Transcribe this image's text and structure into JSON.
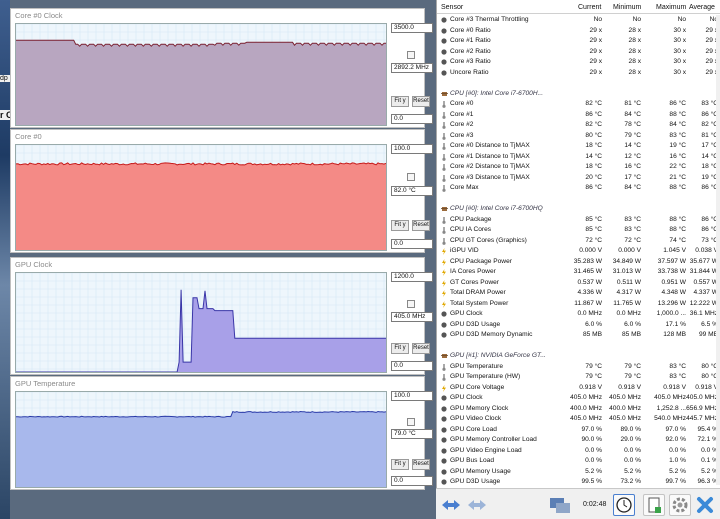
{
  "desktop": {
    "labels": [
      "...",
      "dp",
      "r C"
    ]
  },
  "graphs": [
    {
      "title": "Core #0 Clock",
      "max": "3500.0",
      "current": "2892.2 MHz",
      "min": "0.0",
      "fit": "Fit y",
      "reset": "Reset",
      "fill": "#b8a6c0",
      "line": "#7a2030",
      "grid": "#d6e8f6",
      "level": [
        0.84,
        0.78
      ],
      "kind": "clock"
    },
    {
      "title": "Core #0",
      "max": "100.0",
      "current": "82.0 °C",
      "min": "0.0",
      "fit": "Fit y",
      "reset": "Reset",
      "fill": "#f48a86",
      "line": "#c61a1a",
      "grid": "#d6e8f6",
      "level": [
        0.82,
        0.82
      ],
      "kind": "temp"
    },
    {
      "title": "GPU Clock",
      "max": "1200.0",
      "current": "405.0 MHz",
      "min": "0.0",
      "fit": "Fit y",
      "reset": "Reset",
      "fill": "#a8a0e8",
      "line": "#3a36a8",
      "grid": "#d6e8f6",
      "level": [
        0.0,
        0.34
      ],
      "kind": "gpuclock"
    },
    {
      "title": "GPU Temperature",
      "max": "100.0",
      "current": "79.0 °C",
      "min": "0.0",
      "fit": "Fit y",
      "reset": "Reset",
      "fill": "#a8b8ec",
      "line": "#2a3aa8",
      "grid": "#d6e8f6",
      "level": [
        0.74,
        0.79
      ],
      "kind": "gputemp"
    }
  ],
  "columns": {
    "sensor": "Sensor",
    "current": "Current",
    "minimum": "Minimum",
    "maximum": "Maximum",
    "average": "Average"
  },
  "rows": [
    {
      "n": "Core #3 Thermal Throttling",
      "c": "No",
      "mi": "No",
      "ma": "No",
      "a": "No",
      "icon": "dot"
    },
    {
      "n": "Core #0 Ratio",
      "c": "29 x",
      "mi": "28 x",
      "ma": "30 x",
      "a": "29 x",
      "icon": "dot"
    },
    {
      "n": "Core #1 Ratio",
      "c": "29 x",
      "mi": "28 x",
      "ma": "30 x",
      "a": "29 x",
      "icon": "dot"
    },
    {
      "n": "Core #2 Ratio",
      "c": "29 x",
      "mi": "28 x",
      "ma": "30 x",
      "a": "29 x",
      "icon": "dot"
    },
    {
      "n": "Core #3 Ratio",
      "c": "29 x",
      "mi": "28 x",
      "ma": "30 x",
      "a": "29 x",
      "icon": "dot"
    },
    {
      "n": "Uncore Ratio",
      "c": "29 x",
      "mi": "28 x",
      "ma": "30 x",
      "a": "29 x",
      "icon": "dot"
    },
    {
      "n": "",
      "c": "",
      "mi": "",
      "ma": "",
      "a": "",
      "icon": "none"
    },
    {
      "n": "CPU [#0]: Intel Core i7-6700H...",
      "c": "",
      "mi": "",
      "ma": "",
      "a": "",
      "icon": "chip",
      "group": true
    },
    {
      "n": "Core #0",
      "c": "82 °C",
      "mi": "81 °C",
      "ma": "86 °C",
      "a": "83 °C",
      "icon": "therm"
    },
    {
      "n": "Core #1",
      "c": "86 °C",
      "mi": "84 °C",
      "ma": "88 °C",
      "a": "86 °C",
      "icon": "therm"
    },
    {
      "n": "Core #2",
      "c": "82 °C",
      "mi": "78 °C",
      "ma": "84 °C",
      "a": "82 °C",
      "icon": "therm"
    },
    {
      "n": "Core #3",
      "c": "80 °C",
      "mi": "79 °C",
      "ma": "83 °C",
      "a": "81 °C",
      "icon": "therm"
    },
    {
      "n": "Core #0 Distance to TjMAX",
      "c": "18 °C",
      "mi": "14 °C",
      "ma": "19 °C",
      "a": "17 °C",
      "icon": "therm"
    },
    {
      "n": "Core #1 Distance to TjMAX",
      "c": "14 °C",
      "mi": "12 °C",
      "ma": "16 °C",
      "a": "14 °C",
      "icon": "therm"
    },
    {
      "n": "Core #2 Distance to TjMAX",
      "c": "18 °C",
      "mi": "16 °C",
      "ma": "22 °C",
      "a": "18 °C",
      "icon": "therm"
    },
    {
      "n": "Core #3 Distance to TjMAX",
      "c": "20 °C",
      "mi": "17 °C",
      "ma": "21 °C",
      "a": "19 °C",
      "icon": "therm"
    },
    {
      "n": "Core Max",
      "c": "86 °C",
      "mi": "84 °C",
      "ma": "88 °C",
      "a": "86 °C",
      "icon": "therm"
    },
    {
      "n": "",
      "c": "",
      "mi": "",
      "ma": "",
      "a": "",
      "icon": "none"
    },
    {
      "n": "CPU [#0]: Intel Core i7-6700HQ",
      "c": "",
      "mi": "",
      "ma": "",
      "a": "",
      "icon": "chip",
      "group": true
    },
    {
      "n": "CPU Package",
      "c": "85 °C",
      "mi": "83 °C",
      "ma": "88 °C",
      "a": "86 °C",
      "icon": "therm"
    },
    {
      "n": "CPU IA Cores",
      "c": "85 °C",
      "mi": "83 °C",
      "ma": "88 °C",
      "a": "86 °C",
      "icon": "therm"
    },
    {
      "n": "CPU GT Cores (Graphics)",
      "c": "72 °C",
      "mi": "72 °C",
      "ma": "74 °C",
      "a": "73 °C",
      "icon": "therm"
    },
    {
      "n": "iGPU VID",
      "c": "0.000 V",
      "mi": "0.000 V",
      "ma": "1.045 V",
      "a": "0.038 V",
      "icon": "bolt"
    },
    {
      "n": "CPU Package Power",
      "c": "35.283 W",
      "mi": "34.849 W",
      "ma": "37.597 W",
      "a": "35.677 W",
      "icon": "bolt"
    },
    {
      "n": "IA Cores Power",
      "c": "31.465 W",
      "mi": "31.013 W",
      "ma": "33.738 W",
      "a": "31.844 W",
      "icon": "bolt"
    },
    {
      "n": "GT Cores Power",
      "c": "0.537 W",
      "mi": "0.511 W",
      "ma": "0.951 W",
      "a": "0.557 W",
      "icon": "bolt"
    },
    {
      "n": "Total DRAM Power",
      "c": "4.336 W",
      "mi": "4.317 W",
      "ma": "4.348 W",
      "a": "4.337 W",
      "icon": "bolt"
    },
    {
      "n": "Total System Power",
      "c": "11.867 W",
      "mi": "11.765 W",
      "ma": "13.296 W",
      "a": "12.222 W",
      "icon": "bolt"
    },
    {
      "n": "GPU Clock",
      "c": "0.0 MHz",
      "mi": "0.0 MHz",
      "ma": "1,000.0 ...",
      "a": "36.1 MHz",
      "icon": "dot"
    },
    {
      "n": "GPU D3D Usage",
      "c": "6.0 %",
      "mi": "6.0 %",
      "ma": "17.1 %",
      "a": "6.5 %",
      "icon": "dot"
    },
    {
      "n": "GPU D3D Memory Dynamic",
      "c": "85 MB",
      "mi": "85 MB",
      "ma": "128 MB",
      "a": "99 MB",
      "icon": "dot"
    },
    {
      "n": "",
      "c": "",
      "mi": "",
      "ma": "",
      "a": "",
      "icon": "none"
    },
    {
      "n": "GPU [#1]: NVIDIA GeForce GT...",
      "c": "",
      "mi": "",
      "ma": "",
      "a": "",
      "icon": "chip",
      "group": true
    },
    {
      "n": "GPU Temperature",
      "c": "79 °C",
      "mi": "79 °C",
      "ma": "83 °C",
      "a": "80 °C",
      "icon": "therm"
    },
    {
      "n": "GPU Temperature (HW)",
      "c": "79 °C",
      "mi": "79 °C",
      "ma": "83 °C",
      "a": "80 °C",
      "icon": "therm"
    },
    {
      "n": "GPU Core Voltage",
      "c": "0.918 V",
      "mi": "0.918 V",
      "ma": "0.918 V",
      "a": "0.918 V",
      "icon": "bolt"
    },
    {
      "n": "GPU Clock",
      "c": "405.0 MHz",
      "mi": "405.0 MHz",
      "ma": "405.0 MHz",
      "a": "405.0 MHz",
      "icon": "dot"
    },
    {
      "n": "GPU Memory Clock",
      "c": "400.0 MHz",
      "mi": "400.0 MHz",
      "ma": "1,252.8 ...",
      "a": "656.9 MHz",
      "icon": "dot"
    },
    {
      "n": "GPU Video Clock",
      "c": "405.0 MHz",
      "mi": "405.0 MHz",
      "ma": "540.0 MHz",
      "a": "445.7 MHz",
      "icon": "dot"
    },
    {
      "n": "GPU Core Load",
      "c": "97.0 %",
      "mi": "89.0 %",
      "ma": "97.0 %",
      "a": "95.4 %",
      "icon": "dot"
    },
    {
      "n": "GPU Memory Controller Load",
      "c": "90.0 %",
      "mi": "29.0 %",
      "ma": "92.0 %",
      "a": "72.1 %",
      "icon": "dot"
    },
    {
      "n": "GPU Video Engine Load",
      "c": "0.0 %",
      "mi": "0.0 %",
      "ma": "0.0 %",
      "a": "0.0 %",
      "icon": "dot"
    },
    {
      "n": "GPU Bus Load",
      "c": "0.0 %",
      "mi": "0.0 %",
      "ma": "1.0 %",
      "a": "0.1 %",
      "icon": "dot"
    },
    {
      "n": "GPU Memory Usage",
      "c": "5.2 %",
      "mi": "5.2 %",
      "ma": "5.2 %",
      "a": "5.2 %",
      "icon": "dot"
    },
    {
      "n": "GPU D3D Usage",
      "c": "99.5 %",
      "mi": "73.2 %",
      "ma": "99.7 %",
      "a": "96.3 %",
      "icon": "dot"
    }
  ],
  "toolbar": {
    "timer": "0:02:48"
  },
  "icons": [
    "nav-arrows-icon",
    "network-icon",
    "report-icon",
    "clock-icon",
    "spreadsheet-icon",
    "settings-icon",
    "close-icon"
  ]
}
